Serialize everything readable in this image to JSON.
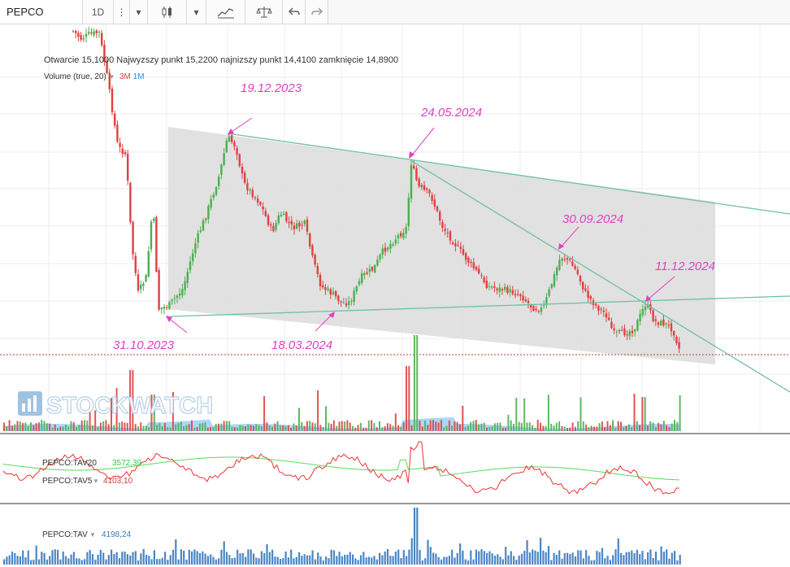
{
  "toolbar": {
    "symbol": "PEPCO",
    "interval": "1D"
  },
  "legend": {
    "open_label": "Otwarcie",
    "open_value": "15,1000",
    "high_label": "Najwyzszy punkt",
    "high_value": "15,2200",
    "low_label": "najnizszy punkt",
    "low_value": "14,4100",
    "close_label": "zamknięcie",
    "close_value": "14,8900",
    "volume_label": "Volume (true, 20)",
    "range_3m": "3M",
    "range_1m": "1M"
  },
  "watermark": "STOCKWATCH",
  "indicators": {
    "tav20_label": "PEPCO:TAV20",
    "tav20_value": "3572,39",
    "tav5_label": "PEPCO:TAV5",
    "tav5_value": "4103,10",
    "tav_label": "PEPCO:TAV",
    "tav_value": "4198,24"
  },
  "colors": {
    "up": "#4caf50",
    "down": "#e04040",
    "annotation": "#e040c0",
    "trendline": "#6fbfa7",
    "channel_fill": "#dcdcdc",
    "volume_ma": "#90caf9",
    "tav20_line": "#55dd55",
    "tav5_line": "#ee3333",
    "tav_bars": "#4a86c5"
  },
  "chart_data": {
    "type": "candlestick",
    "title": "PEPCO",
    "interval": "1D",
    "x_range": [
      "2023-09",
      "2025-01"
    ],
    "y_range_approx": [
      14,
      40
    ],
    "last_bar": {
      "open": 15.1,
      "high": 15.22,
      "low": 14.41,
      "close": 14.89
    },
    "annotations": [
      {
        "date_label": "31.10.2023",
        "type": "low"
      },
      {
        "date_label": "19.12.2023",
        "type": "high"
      },
      {
        "date_label": "18.03.2024",
        "type": "low"
      },
      {
        "date_label": "24.05.2024",
        "type": "high"
      },
      {
        "date_label": "30.09.2024",
        "type": "high"
      },
      {
        "date_label": "11.12.2024",
        "type": "high"
      }
    ],
    "drawn_objects": [
      "descending channel (shaded)",
      "upper trendline",
      "lower trendline",
      "steep resistance line",
      "horizontal dotted line at last close"
    ],
    "indicators": [
      {
        "name": "PEPCO:TAV20",
        "last_value": 3572.39
      },
      {
        "name": "PEPCO:TAV5",
        "last_value": 4103.1
      },
      {
        "name": "PEPCO:TAV",
        "last_value": 4198.24
      }
    ]
  }
}
